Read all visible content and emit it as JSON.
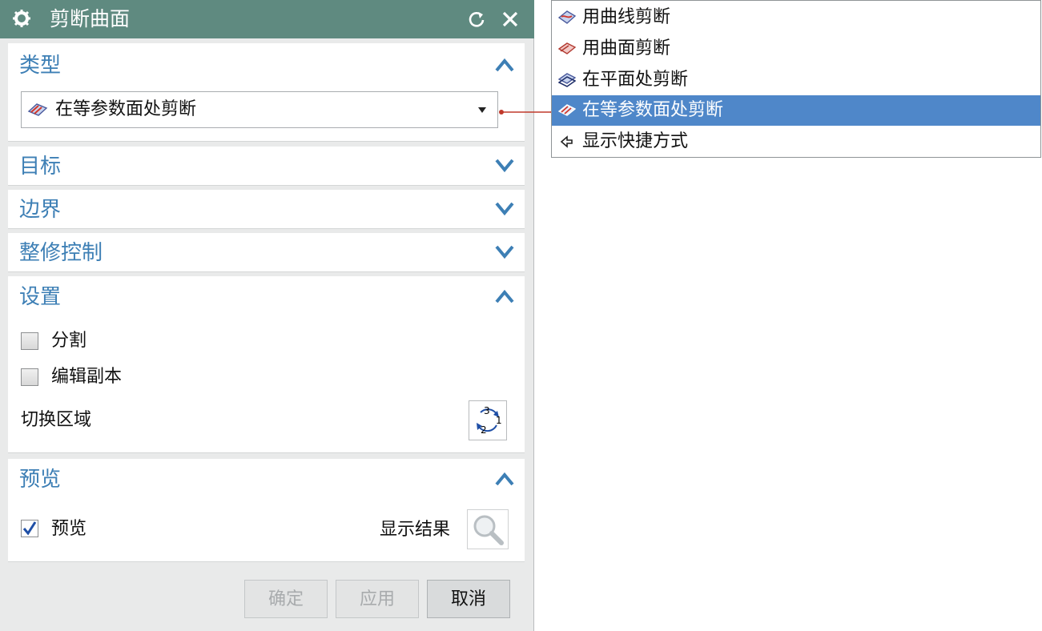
{
  "dialog": {
    "title": "剪断曲面",
    "sections": {
      "type": {
        "title": "类型",
        "selected": "在等参数面处剪断"
      },
      "target": {
        "title": "目标"
      },
      "boundary": {
        "title": "边界"
      },
      "trim_control": {
        "title": "整修控制"
      },
      "settings": {
        "title": "设置",
        "split_label": "分割",
        "split_checked": false,
        "edit_copy_label": "编辑副本",
        "edit_copy_checked": false,
        "switch_region_label": "切换区域"
      },
      "preview": {
        "title": "预览",
        "preview_label": "预览",
        "preview_checked": true,
        "show_result_label": "显示结果"
      }
    },
    "buttons": {
      "ok": "确定",
      "apply": "应用",
      "cancel": "取消"
    }
  },
  "dropdown": {
    "items": [
      {
        "label": "用曲线剪断",
        "icon": "trim-by-curve-icon"
      },
      {
        "label": "用曲面剪断",
        "icon": "trim-by-surface-icon"
      },
      {
        "label": "在平面处剪断",
        "icon": "trim-at-plane-icon"
      },
      {
        "label": "在等参数面处剪断",
        "icon": "trim-at-isoparametric-icon",
        "selected": true
      },
      {
        "label": "显示快捷方式",
        "icon": "show-shortcuts-icon"
      }
    ]
  },
  "colors": {
    "titlebar": "#5f8a80",
    "section_title": "#3d7fb5",
    "selection": "#4f87c9",
    "connector": "#c0392b"
  }
}
